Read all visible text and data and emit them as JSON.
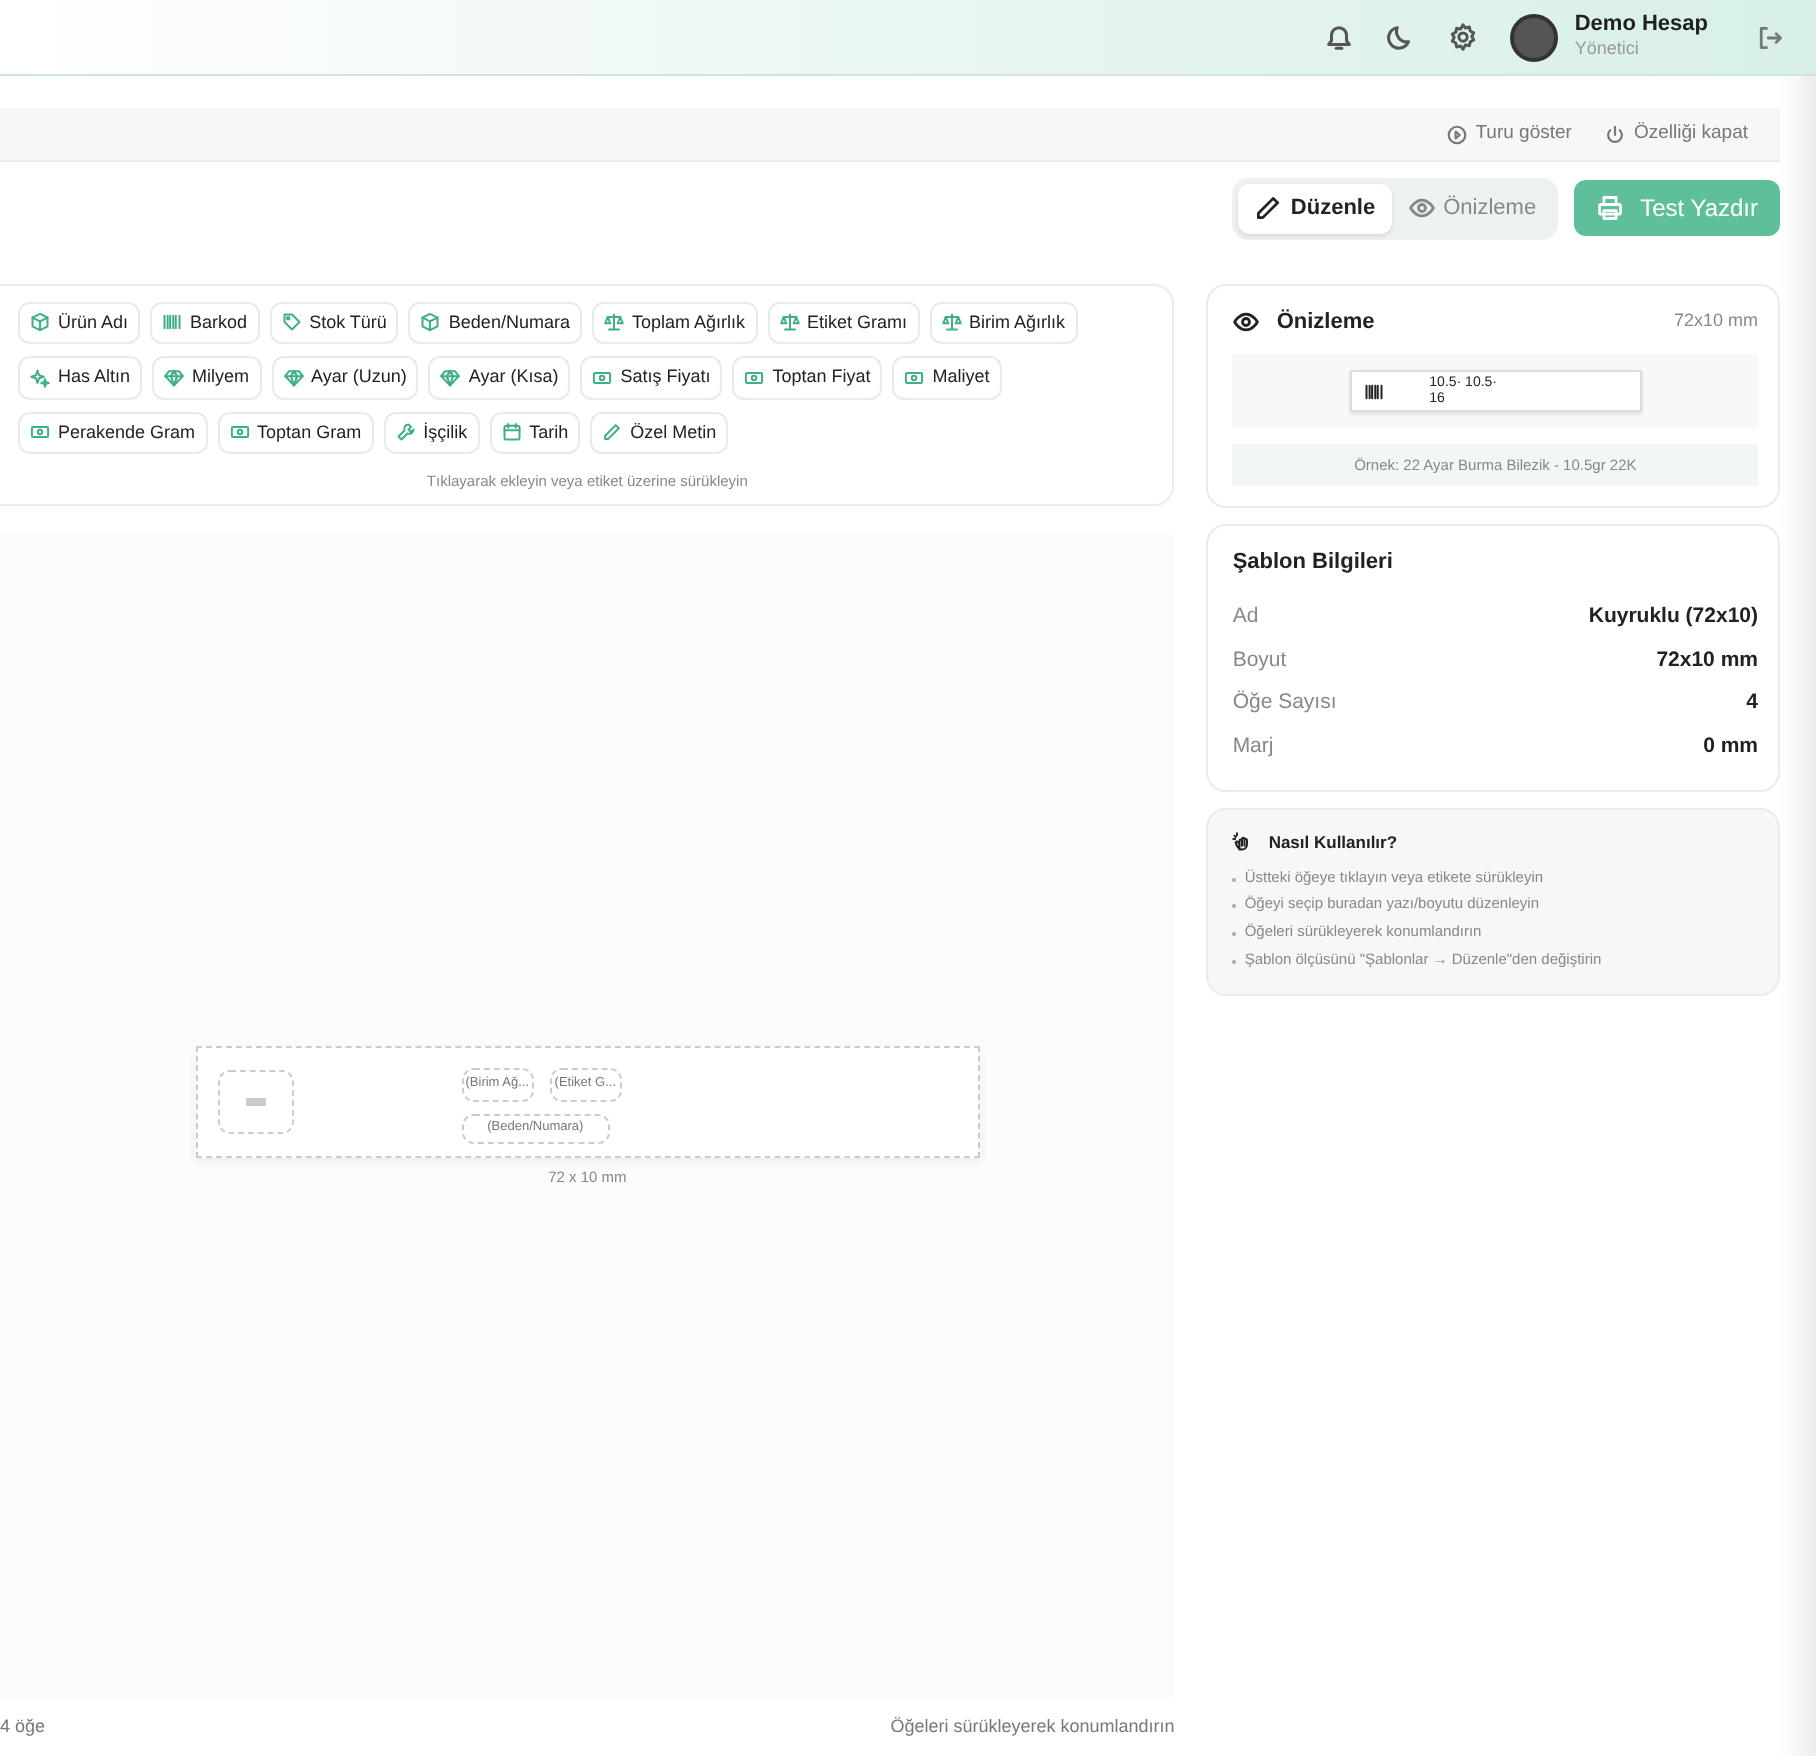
{
  "header": {
    "user_name": "Demo Hesap",
    "user_role": "Yönetici"
  },
  "subbar": {
    "links": [
      "Turu göster",
      "Özelliği kapat"
    ]
  },
  "mode_tabs": [
    {
      "label": "Düzenle",
      "kind": "pencil",
      "selected": true
    },
    {
      "label": "Önizleme",
      "kind": "eye",
      "selected": false
    }
  ],
  "print_button": "Test Yazdır",
  "palette": {
    "items": [
      {
        "label": "Ürün Adı",
        "kind": "box"
      },
      {
        "label": "Barkod",
        "kind": "barcode"
      },
      {
        "label": "Stok Türü",
        "kind": "tag"
      },
      {
        "label": "Beden/Numara",
        "kind": "box"
      },
      {
        "label": "Toplam Ağırlık",
        "kind": "scale"
      },
      {
        "label": "Etiket Gramı",
        "kind": "scale"
      },
      {
        "label": "Birim Ağırlık",
        "kind": "scale"
      },
      {
        "label": "Has Altın",
        "kind": "sparkle"
      },
      {
        "label": "Milyem",
        "kind": "gem"
      },
      {
        "label": "Ayar (Uzun)",
        "kind": "gem"
      },
      {
        "label": "Ayar (Kısa)",
        "kind": "gem"
      },
      {
        "label": "Satış Fiyatı",
        "kind": "cash"
      },
      {
        "label": "Toptan Fiyat",
        "kind": "cash"
      },
      {
        "label": "Maliyet",
        "kind": "cash"
      },
      {
        "label": "Perakende Gram",
        "kind": "cash"
      },
      {
        "label": "Toptan Gram",
        "kind": "cash"
      },
      {
        "label": "İşçilik",
        "kind": "wrench"
      },
      {
        "label": "Tarih",
        "kind": "calendar"
      },
      {
        "label": "Özel Metin",
        "kind": "pencil"
      }
    ],
    "hint": "Tıklayarak ekleyin veya etiket üzerine sürükleyin"
  },
  "canvas": {
    "elements": [
      {
        "kind": "image"
      },
      {
        "kind": "text",
        "label": "(Birim Ağ..."
      },
      {
        "kind": "text",
        "label": "(Etiket G..."
      },
      {
        "kind": "text",
        "label": "(Beden/Numara)"
      }
    ],
    "size_caption": "72 x 10 mm"
  },
  "footer": {
    "count": "4 öğe",
    "hint": "Öğeleri sürükleyerek konumlandırın"
  },
  "preview": {
    "title": "Önizleme",
    "size": "72x10 mm",
    "lines": [
      "10.5· 10.5·",
      "16"
    ],
    "example": "Örnek: 22 Ayar Burma Bilezik - 10.5gr 22K"
  },
  "template_info": {
    "title": "Şablon Bilgileri",
    "rows": [
      {
        "label": "Ad",
        "value": "Kuyruklu (72x10)"
      },
      {
        "label": "Boyut",
        "value": "72x10 mm"
      },
      {
        "label": "Öğe Sayısı",
        "value": "4"
      },
      {
        "label": "Marj",
        "value": "0 mm"
      }
    ]
  },
  "help": {
    "title": "Nasıl Kullanılır?",
    "tips": [
      "Üstteki öğeye tıklayın veya etikete sürükleyin",
      "Öğeyi seçip buradan yazı/boyutu düzenleyin",
      "Öğeleri sürükleyerek konumlandırın",
      "Şablon ölçüsünü \"Şablonlar → Düzenle\"den değiştirin"
    ]
  }
}
